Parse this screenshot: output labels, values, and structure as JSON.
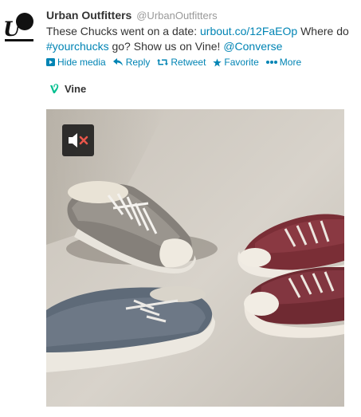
{
  "account": {
    "name": "Urban Outfitters",
    "handle": "@UrbanOutfitters",
    "avatar_text": "UO"
  },
  "tweet": {
    "text_1": "These Chucks went on a date: ",
    "link": "urbout.co/12FaEOp",
    "text_2": "  Where do ",
    "hashtag": "#yourchucks",
    "text_3": " go? Show us on Vine! ",
    "mention": "@Converse"
  },
  "actions": {
    "hide_media": "Hide media",
    "reply": "Reply",
    "retweet": "Retweet",
    "favorite": "Favorite",
    "more": "More"
  },
  "card": {
    "source_label": "Vine"
  },
  "colors": {
    "link": "#0084b4",
    "vine_green": "#00bf8f",
    "mute_x": "#e8564a"
  },
  "icons": [
    "play-box-icon",
    "reply-icon",
    "retweet-icon",
    "star-icon",
    "ellipsis-icon",
    "vine-icon",
    "speaker-muted-icon"
  ]
}
